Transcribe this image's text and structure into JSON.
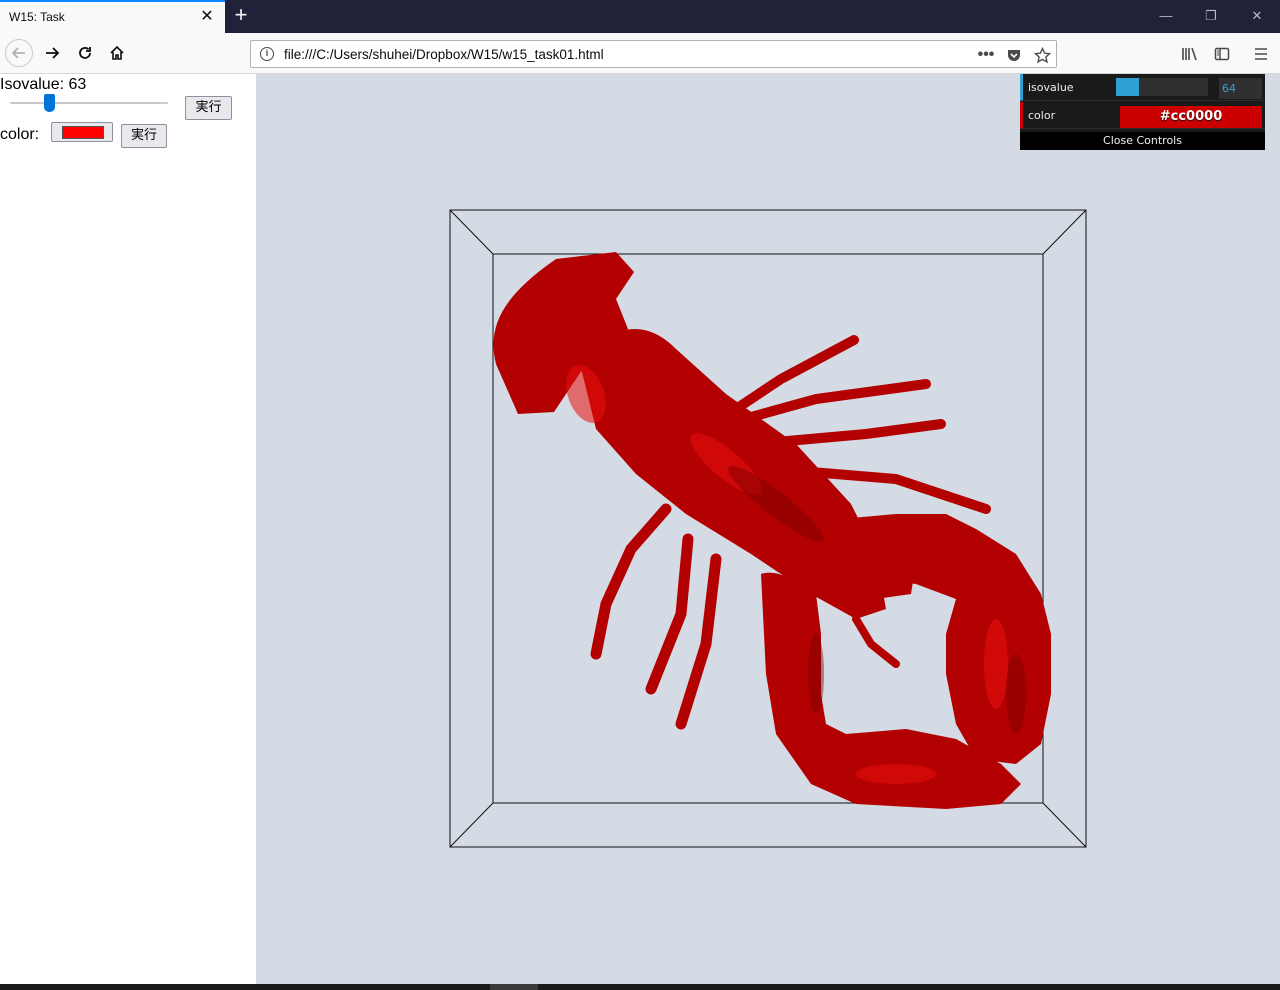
{
  "tab": {
    "title": "W15: Task"
  },
  "url": "file:///C:/Users/shuhei/Dropbox/W15/w15_task01.html",
  "controls": {
    "isovalue_label": "Isovalue: 63",
    "isovalue": 63,
    "isovalue_range": [
      0,
      255
    ],
    "run_label": "実行",
    "color_label": "color:",
    "color_value": "#ff0000"
  },
  "gui": {
    "isovalue_name": "isovalue",
    "isovalue_value": "64",
    "isovalue_fraction": 0.25,
    "color_name": "color",
    "color_value": "#cc0000",
    "close_label": "Close Controls"
  },
  "scene": {
    "background": "#d4dbe5",
    "mesh_color": "#b30000",
    "icons": [
      "back-icon",
      "forward-icon",
      "reload-icon",
      "home-icon",
      "info-icon",
      "more-icon",
      "pocket-icon",
      "star-icon",
      "library-icon",
      "sidebar-icon",
      "menu-icon"
    ]
  }
}
